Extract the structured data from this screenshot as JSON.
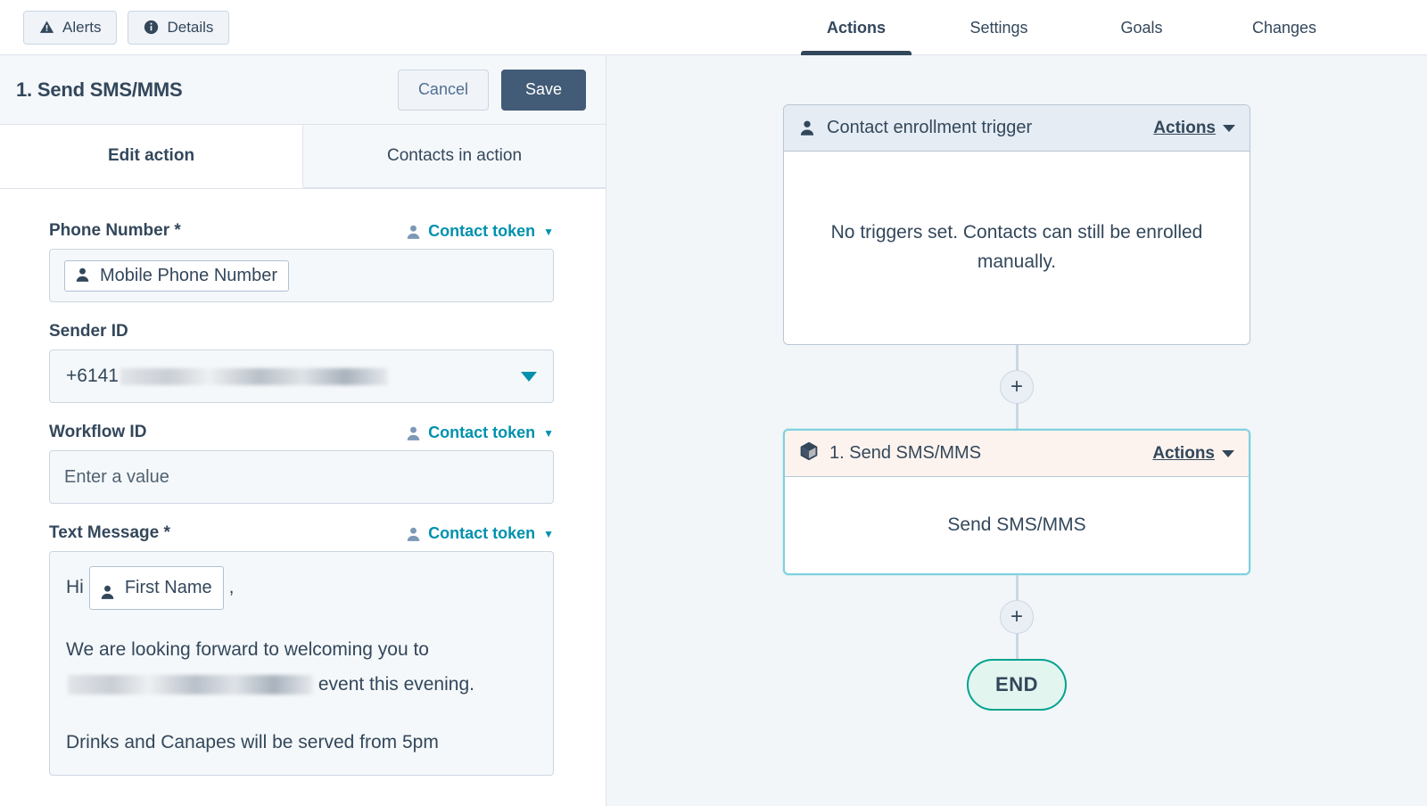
{
  "topbar": {
    "buttons": [
      {
        "label": "Alerts",
        "icon": "warning-triangle-icon"
      },
      {
        "label": "Details",
        "icon": "info-circle-icon"
      }
    ],
    "tabs": [
      {
        "label": "Actions",
        "active": true
      },
      {
        "label": "Settings",
        "active": false
      },
      {
        "label": "Goals",
        "active": false
      },
      {
        "label": "Changes",
        "active": false
      }
    ]
  },
  "panel": {
    "title": "1. Send SMS/MMS",
    "cancel_label": "Cancel",
    "save_label": "Save",
    "tabs": [
      {
        "label": "Edit action",
        "active": true
      },
      {
        "label": "Contacts in action",
        "active": false
      }
    ],
    "token_link_label": "Contact token",
    "fields": {
      "phone_number": {
        "label": "Phone Number *",
        "token_chip": "Mobile Phone Number",
        "has_token_link": true
      },
      "sender_id": {
        "label": "Sender ID",
        "value_visible": "+6141",
        "value_redacted": true,
        "has_token_link": false
      },
      "workflow_id": {
        "label": "Workflow ID",
        "placeholder": "Enter a value",
        "has_token_link": true
      },
      "text_message": {
        "label": "Text Message *",
        "has_token_link": true,
        "greeting_prefix": "Hi",
        "greeting_token": "First Name",
        "greeting_suffix": ",",
        "line_2_before": "We are looking forward to welcoming you to",
        "line_2_redacted": true,
        "line_2_after": "event this evening.",
        "line_3": "Drinks and Canapes will be served from 5pm"
      }
    }
  },
  "canvas": {
    "trigger_node": {
      "title": "Contact enrollment trigger",
      "icon": "contact-person-icon",
      "actions_label": "Actions",
      "body": "No triggers set. Contacts can still be enrolled manually."
    },
    "action_node": {
      "title": "1. Send SMS/MMS",
      "icon": "cube-icon",
      "actions_label": "Actions",
      "body": "Send SMS/MMS"
    },
    "add_button_label": "+",
    "end_node_label": "END"
  },
  "colors": {
    "accent_teal": "#0091AE",
    "dark_slate": "#33475B",
    "save_button": "#425B76",
    "canvas_bg": "#F2F6F9",
    "action_node_border": "#7FD1DE",
    "action_node_header": "#FDF3EE",
    "end_node_border": "#00A38D",
    "end_node_bg": "#E3F5EF"
  }
}
